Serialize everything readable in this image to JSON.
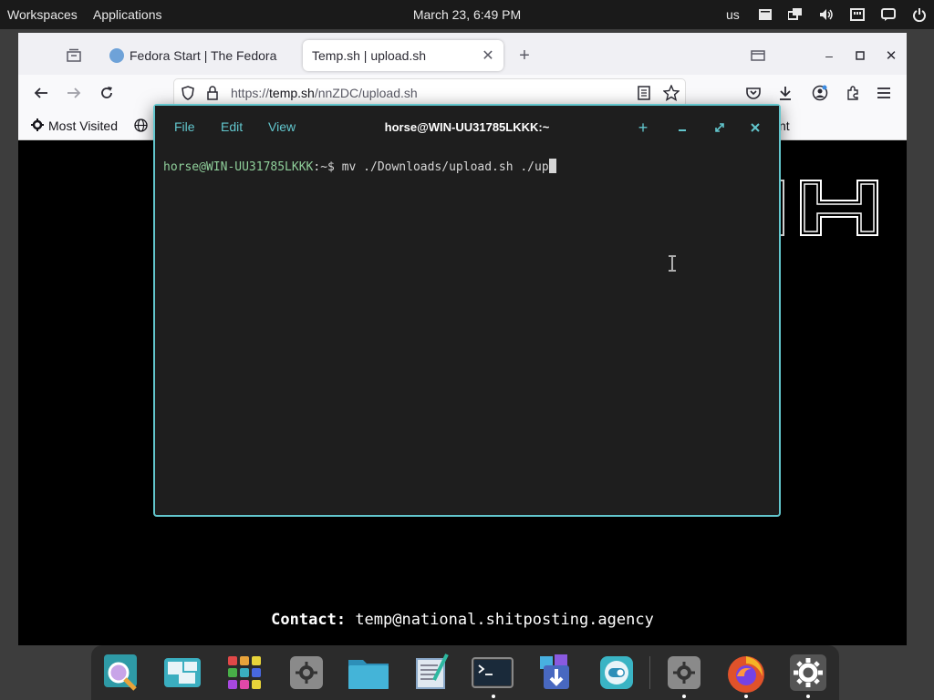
{
  "top_panel": {
    "workspaces": "Workspaces",
    "applications": "Applications",
    "clock": "March 23, 6:49 PM",
    "keyboard_layout": "us"
  },
  "browser": {
    "tabs": [
      {
        "title": "Fedora Start | The Fedora",
        "active": false
      },
      {
        "title": "Temp.sh | upload.sh",
        "active": true
      }
    ],
    "url_prefix": "https://",
    "url_host": "temp.sh",
    "url_path": "/nnZDC/upload.sh",
    "bookmarks": {
      "most_visited": "Most Visited",
      "partial_right": "nt"
    },
    "content": {
      "contact_label": "Contact:",
      "contact_value": "temp@national.shitposting.agency"
    }
  },
  "terminal": {
    "menu": [
      "File",
      "Edit",
      "View"
    ],
    "title": "horse@WIN-UU31785LKKK:~",
    "prompt_user": "horse@WIN-UU31785LKKK",
    "prompt_suffix": ":~$ ",
    "command": "mv ./Downloads/upload.sh ./up"
  },
  "dock": {
    "items": [
      {
        "name": "search-app",
        "running": false
      },
      {
        "name": "workspaces-app",
        "running": false
      },
      {
        "name": "app-grid",
        "running": false
      },
      {
        "name": "tweaks-app",
        "running": false
      },
      {
        "name": "files-app",
        "running": false
      },
      {
        "name": "text-editor-app",
        "running": false
      },
      {
        "name": "terminal-app",
        "running": true
      },
      {
        "name": "software-app",
        "running": false
      },
      {
        "name": "toggle-app",
        "running": false
      },
      {
        "name": "tweaks-app-2",
        "running": true
      },
      {
        "name": "firefox-app",
        "running": true
      },
      {
        "name": "settings-app",
        "running": true
      }
    ]
  },
  "colors": {
    "terminal_accent": "#62c6cd",
    "prompt_green": "#8fcf9a",
    "panel_bg": "#1a1a1a"
  }
}
